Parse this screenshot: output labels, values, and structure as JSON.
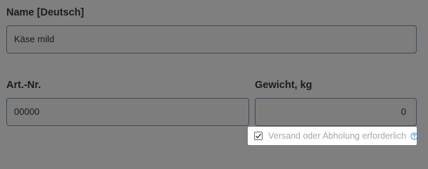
{
  "form": {
    "name_label": "Name [Deutsch]",
    "name_value": "Käse mild",
    "art_label": "Art.-Nr.",
    "art_value": "00000",
    "weight_label": "Gewicht, kg",
    "weight_value": "0",
    "shipping_checkbox_label": "Versand oder Abholung erforderlich",
    "shipping_checked": true
  },
  "icons": {
    "checkbox_check": "check-icon",
    "help": "question-circle-icon"
  },
  "colors": {
    "overlay_bg": "#7f7f7f",
    "input_border": "#3f4a57",
    "help_icon": "#3a8fd6",
    "checkbox_text": "#a8a8a8"
  }
}
